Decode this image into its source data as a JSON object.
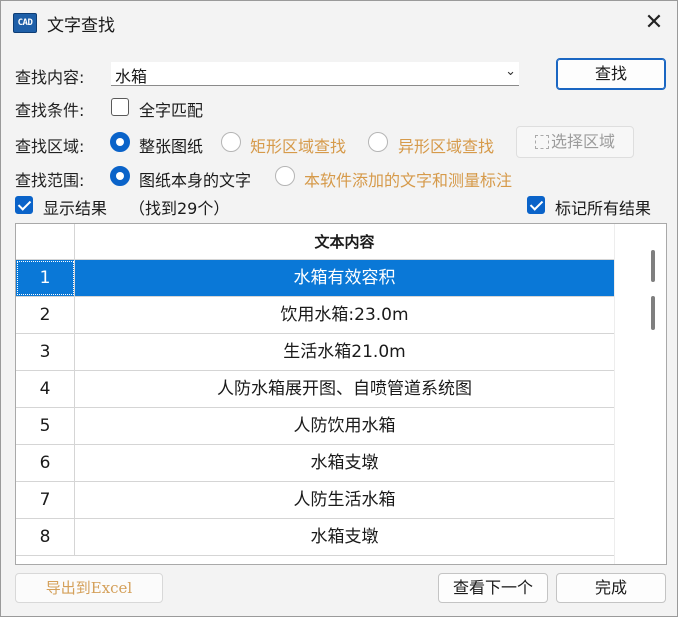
{
  "window": {
    "title": "文字查找",
    "icon_text": "CAD"
  },
  "search": {
    "label": "查找内容:",
    "value": "水箱",
    "find_button": "查找"
  },
  "conditions": {
    "label": "查找条件:",
    "whole_word_label": "全字匹配",
    "whole_word_checked": false
  },
  "area": {
    "label": "查找区域:",
    "options": [
      {
        "label": "整张图纸",
        "selected": true,
        "enabled": true
      },
      {
        "label": "矩形区域查找",
        "selected": false,
        "enabled": false
      },
      {
        "label": "异形区域查找",
        "selected": false,
        "enabled": false
      }
    ],
    "select_region_button": "选择区域"
  },
  "scope": {
    "label": "查找范围:",
    "options": [
      {
        "label": "图纸本身的文字",
        "selected": true,
        "enabled": true
      },
      {
        "label": "本软件添加的文字和测量标注",
        "selected": false,
        "enabled": false
      }
    ]
  },
  "results_bar": {
    "show_results_label": "显示结果",
    "show_results_checked": true,
    "count_text": "（找到29个）",
    "mark_all_label": "标记所有结果",
    "mark_all_checked": true
  },
  "table": {
    "header": "文本内容",
    "selected_index": 0,
    "rows": [
      {
        "num": "1",
        "text": "水箱有效容积"
      },
      {
        "num": "2",
        "text": "饮用水箱:23.0m"
      },
      {
        "num": "3",
        "text": "生活水箱21.0m"
      },
      {
        "num": "4",
        "text": "人防水箱展开图、自喷管道系统图"
      },
      {
        "num": "5",
        "text": "人防饮用水箱"
      },
      {
        "num": "6",
        "text": "水箱支墩"
      },
      {
        "num": "7",
        "text": "人防生活水箱"
      },
      {
        "num": "8",
        "text": "水箱支墩"
      }
    ]
  },
  "footer": {
    "export_button": "导出到Excel",
    "next_button": "查看下一个",
    "done_button": "完成"
  },
  "colors": {
    "accent": "#0a63c9",
    "selection": "#0a78d7",
    "disabled_text": "#d69a4a"
  }
}
